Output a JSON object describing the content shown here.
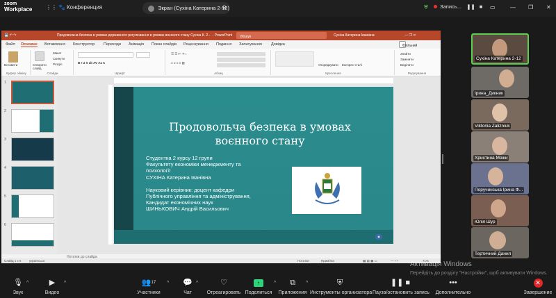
{
  "app": {
    "logo_line1": "zoom",
    "logo_line2": "Workplace",
    "conference_label": "Конференция",
    "screen_share_label": "Экран (Сухіна Катерина 2-12)",
    "recording_label": "Запись..."
  },
  "ppt": {
    "doc_title": "Продовольча безпека в умовах державного регулювання в умовах воєнного стану Сухіна К. 2…  -  PowerPoint",
    "search_placeholder": "Пошук",
    "user_name": "Сухіна Катерина Іванівна",
    "share_label": "Спільний доступ",
    "menu": [
      "Файл",
      "Основне",
      "Вставлення",
      "Конструктор",
      "Переходи",
      "Анімація",
      "Показ слайдів",
      "Рецензування",
      "Подання",
      "Записування",
      "Довідка"
    ],
    "ribbon_groups": [
      "Буфер обміну",
      "Слайди",
      "Шрифт",
      "Абзац",
      "Креслення",
      "Редагування"
    ],
    "clipboard_items": [
      "Вставити",
      "Створити слайд"
    ],
    "slides_items": [
      "Макет",
      "Скинути",
      "Розділ"
    ],
    "drawing_items": [
      "Упорядкувати",
      "Експрес-стилі"
    ],
    "editing_items": [
      "Знайти",
      "Замінити",
      "Виділити"
    ],
    "slide_numbers": [
      "1",
      "2",
      "3",
      "4",
      "5",
      "6"
    ],
    "notes_placeholder": "Нотатки до слайда",
    "status_slide": "Слайд 1 з 6",
    "status_lang": "українська",
    "status_notes": "Нотатки",
    "status_comments": "Примітки",
    "zoom_level": "71%"
  },
  "slide": {
    "title_line1": "Продовольча безпека в умовах",
    "title_line2": "воєнного стану",
    "body": [
      "Студентка 2 курсу 12 групи",
      "Факультету економіки менеджменту та",
      "психології",
      "СУХІНА Катерина Іванівна",
      "",
      "Науковий керівник: доцент кафедри",
      "Публічного управління та адміністрування,",
      "Кандидат економічних наук",
      "ШИНЬКОВИЧ Андрій Васильович"
    ]
  },
  "participants": [
    {
      "name": "Сухіна Катерина 2-12"
    },
    {
      "name": "Ірина_Дикник"
    },
    {
      "name": "Viktoriia Zalizniuk"
    },
    {
      "name": "Христина Можи"
    },
    {
      "name": "Поручинська Ірина Ф..."
    },
    {
      "name": "Юлія Шур"
    },
    {
      "name": "Тертичний Данил"
    }
  ],
  "watermark": {
    "line1": "Активація Windows",
    "line2": "Перейдіть до розділу \"Настройки\", щоб активувати Windows."
  },
  "toolbar": {
    "audio": "Звук",
    "video": "Видео",
    "participants": "Участники",
    "participants_count": "17",
    "chat": "Чат",
    "react": "Отреагировать",
    "share": "Поделиться",
    "apps": "Приложения",
    "host_tools": "Инструменты организатора",
    "pause_rec": "Пауза/остановить запись",
    "more": "Дополнительно",
    "end": "Завершение"
  }
}
